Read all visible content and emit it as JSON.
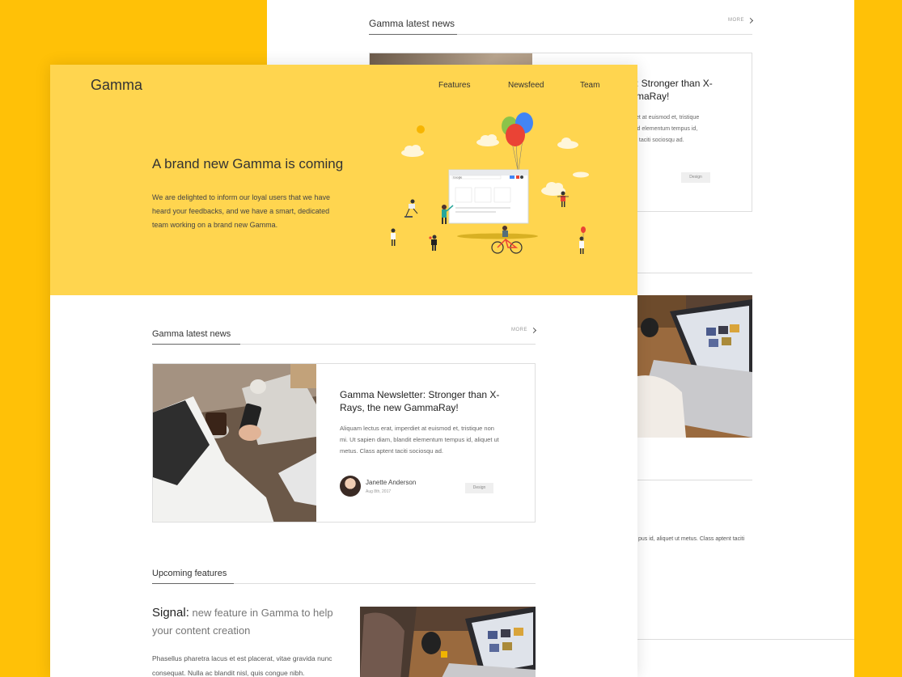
{
  "brand": {
    "logo": "Gamma"
  },
  "nav": {
    "features": "Features",
    "newsfeed": "Newsfeed",
    "team": "Team"
  },
  "hero": {
    "title": "A brand new Gamma is coming",
    "description": "We are delighted to inform our loyal users that we have heard your feedbacks, and we have a smart, dedicated team working on a brand new Gamma.",
    "browser_search": "Google"
  },
  "news": {
    "title": "Gamma latest news",
    "more": "MORE",
    "card": {
      "title": "Gamma Newsletter: Stronger than X-Rays, the new GammaRay!",
      "body": "Aliquam lectus erat, imperdiet at euismod et, tristique non mi. Ut sapien diam, blandit elementum tempus id, aliquet ut metus. Class aptent taciti sociosqu ad.",
      "author": "Janette Anderson",
      "date": "Aug 8th, 2017",
      "tag": "Design"
    }
  },
  "features": {
    "title": "Upcoming features",
    "item_lead": "Signal:",
    "item_title": " new feature in Gamma to help your content creation",
    "item_body": "Phasellus pharetra lacus et est placerat, vitae gravida nunc consequat. Nulla ac blandit nisl, quis congue nibh."
  },
  "back_sheet": {
    "news_title": "Gamma latest news",
    "more": "MORE",
    "card_title": ": Stronger than X-\nmaRay!",
    "card_body": "et at euismod et, tristique\nid elementum tempus id,\nt taciti sociosqu ad.",
    "tag": "Design",
    "text_fragment": "pus id, aliquet ut metus. Class aptent taciti"
  },
  "colors": {
    "background": "#FFC107",
    "hero": "#FFD54F"
  }
}
